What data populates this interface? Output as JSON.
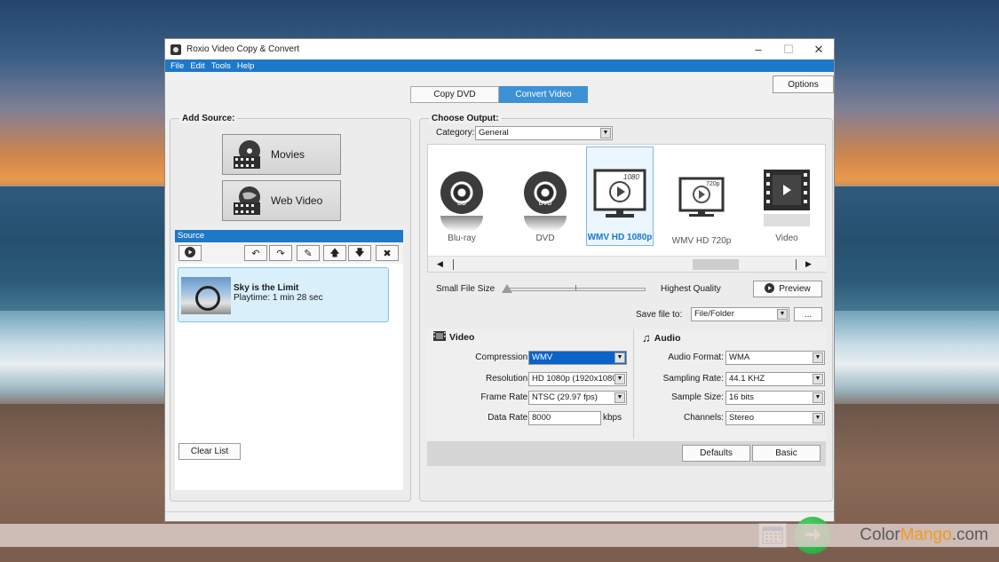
{
  "window": {
    "title": "Roxio Video Copy & Convert",
    "controls": {
      "minimize": "–",
      "maximize": "☐",
      "close": "✕"
    }
  },
  "menu": [
    "File",
    "Edit",
    "Tools",
    "Help"
  ],
  "tabs": [
    {
      "label": "Copy DVD",
      "active": false
    },
    {
      "label": "Convert Video",
      "active": true
    }
  ],
  "options_label": "Options",
  "left": {
    "title": "Add Source:",
    "movies_label": "Movies",
    "web_label": "Web Video",
    "source_header": "Source",
    "item": {
      "title": "Sky is the Limit",
      "playtime": "Playtime: 1 min 28 sec"
    },
    "clear_label": "Clear List"
  },
  "right": {
    "title": "Choose Output:",
    "category_label": "Category:",
    "category_value": "General",
    "formats": [
      {
        "label": "Blu-ray",
        "selected": false
      },
      {
        "label": "DVD",
        "selected": false
      },
      {
        "label": "WMV HD 1080p",
        "selected": true
      },
      {
        "label": "WMV HD 720p",
        "selected": false
      },
      {
        "label": "Video",
        "selected": false
      }
    ],
    "disc_bd": "BD",
    "disc_dvd": "DVD",
    "badge_1080": "1080",
    "badge_720": "720p",
    "small_label": "Small File Size",
    "high_label": "Highest Quality",
    "preview_label": "Preview",
    "save_label": "Save file to:",
    "save_value": "File/Folder",
    "browse_label": "...",
    "video": {
      "title": "Video",
      "compression_label": "Compression:",
      "compression_value": "WMV",
      "resolution_label": "Resolution:",
      "resolution_value": "HD 1080p (1920x1080)",
      "framerate_label": "Frame Rate:",
      "framerate_value": "NTSC (29.97 fps)",
      "datarate_label": "Data Rate:",
      "datarate_value": "8000",
      "datarate_unit": "kbps"
    },
    "audio": {
      "title": "Audio",
      "format_label": "Audio Format:",
      "format_value": "WMA",
      "sampling_label": "Sampling Rate:",
      "sampling_value": "44.1 KHZ",
      "samplesize_label": "Sample Size:",
      "samplesize_value": "16 bits",
      "channels_label": "Channels:",
      "channels_value": "Stereo"
    },
    "defaults_label": "Defaults",
    "basic_label": "Basic"
  },
  "watermark": {
    "color": "Color",
    "mango": "Mango",
    "com": ".com"
  },
  "colors": {
    "accent": "#1e78c8",
    "go": "#1e9e37"
  }
}
